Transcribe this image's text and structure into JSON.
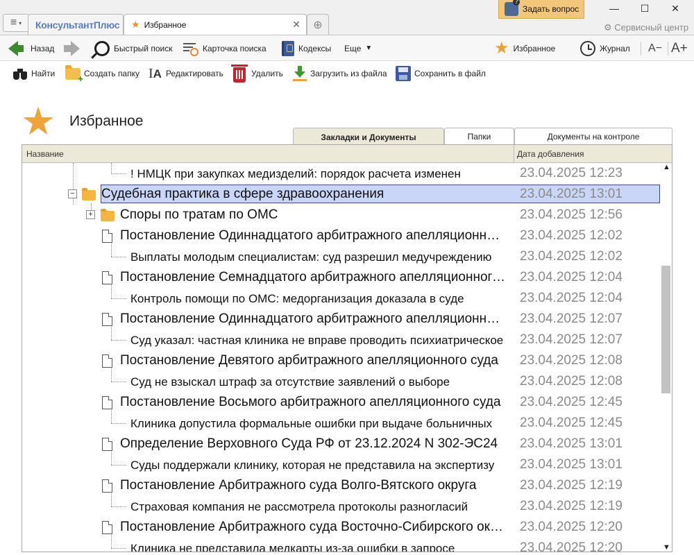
{
  "window": {
    "logo": "КонсультантПлюс",
    "tab_label": "Избранное",
    "ask_button": "Задать вопрос",
    "service_center": "Сервисный центр"
  },
  "toolbar": {
    "back": "Назад",
    "quick_search": "Быстрый поиск",
    "search_card": "Карточка поиска",
    "codexes": "Кодексы",
    "more": "Еще",
    "favorites": "Избранное",
    "journal": "Журнал",
    "font_smaller": "A−",
    "font_larger": "A+"
  },
  "actions": {
    "find": "Найти",
    "create_folder": "Создать папку",
    "edit": "Редактировать",
    "delete": "Удалить",
    "load_from_file": "Загрузить из файла",
    "save_to_file": "Сохранить в файл"
  },
  "page": {
    "title": "Избранное"
  },
  "tabs": [
    {
      "label": "Закладки и Документы"
    },
    {
      "label": "Папки"
    },
    {
      "label": "Документы на контроле"
    }
  ],
  "table": {
    "col_name": "Название",
    "col_date": "Дата добавления",
    "rows": [
      {
        "name": "! НМЦК при закупках медизделий: порядок расчета изменен",
        "date": "23.04.2025 12:23"
      },
      {
        "name": "Судебная практика в сфере здравоохранения",
        "date": "23.04.2025 13:01"
      },
      {
        "name": "Споры по тратам по ОМС",
        "date": "23.04.2025 12:56"
      },
      {
        "name": "Постановление Одиннадцатого арбитражного апелляционного суда",
        "date": "23.04.2025 12:02"
      },
      {
        "name": "Выплаты молодым специалистам: суд разрешил медучреждению",
        "date": "23.04.2025 12:02"
      },
      {
        "name": "Постановление Семнадцатого арбитражного апелляционного суда",
        "date": "23.04.2025 12:04"
      },
      {
        "name": "Контроль помощи по ОМС: медорганизация доказала в суде",
        "date": "23.04.2025 12:04"
      },
      {
        "name": "Постановление Одиннадцатого арбитражного апелляционного суда",
        "date": "23.04.2025 12:07"
      },
      {
        "name": "Суд указал: частная клиника не вправе проводить психиатрическое",
        "date": "23.04.2025 12:07"
      },
      {
        "name": "Постановление Девятого арбитражного апелляционного суда",
        "date": "23.04.2025 12:08"
      },
      {
        "name": "Суд не взыскал штраф за отсутствие заявлений о выборе",
        "date": "23.04.2025 12:08"
      },
      {
        "name": "Постановление Восьмого арбитражного апелляционного суда",
        "date": "23.04.2025 12:45"
      },
      {
        "name": "Клиника допустила формальные ошибки при выдаче больничных",
        "date": "23.04.2025 12:45"
      },
      {
        "name": "Определение Верховного Суда РФ от 23.12.2024 N 302-ЭС24",
        "date": "23.04.2025 13:01"
      },
      {
        "name": "Суды поддержали клинику, которая не представила на экспертизу",
        "date": "23.04.2025 13:01"
      },
      {
        "name": "Постановление Арбитражного суда Волго-Вятского округа",
        "date": "23.04.2025 12:19"
      },
      {
        "name": "Страховая компания не рассмотрела протоколы разногласий",
        "date": "23.04.2025 12:19"
      },
      {
        "name": "Постановление Арбитражного суда Восточно-Сибирского округа",
        "date": "23.04.2025 12:20"
      },
      {
        "name": "Клиника не представила медкарты из-за ошибки в запросе",
        "date": "23.04.2025 12:20"
      }
    ]
  },
  "colors": {
    "selection": "#cad6f7",
    "favorite_star": "#efa43a",
    "folder": "#f5b63f",
    "date_text": "#8a8a8a"
  }
}
